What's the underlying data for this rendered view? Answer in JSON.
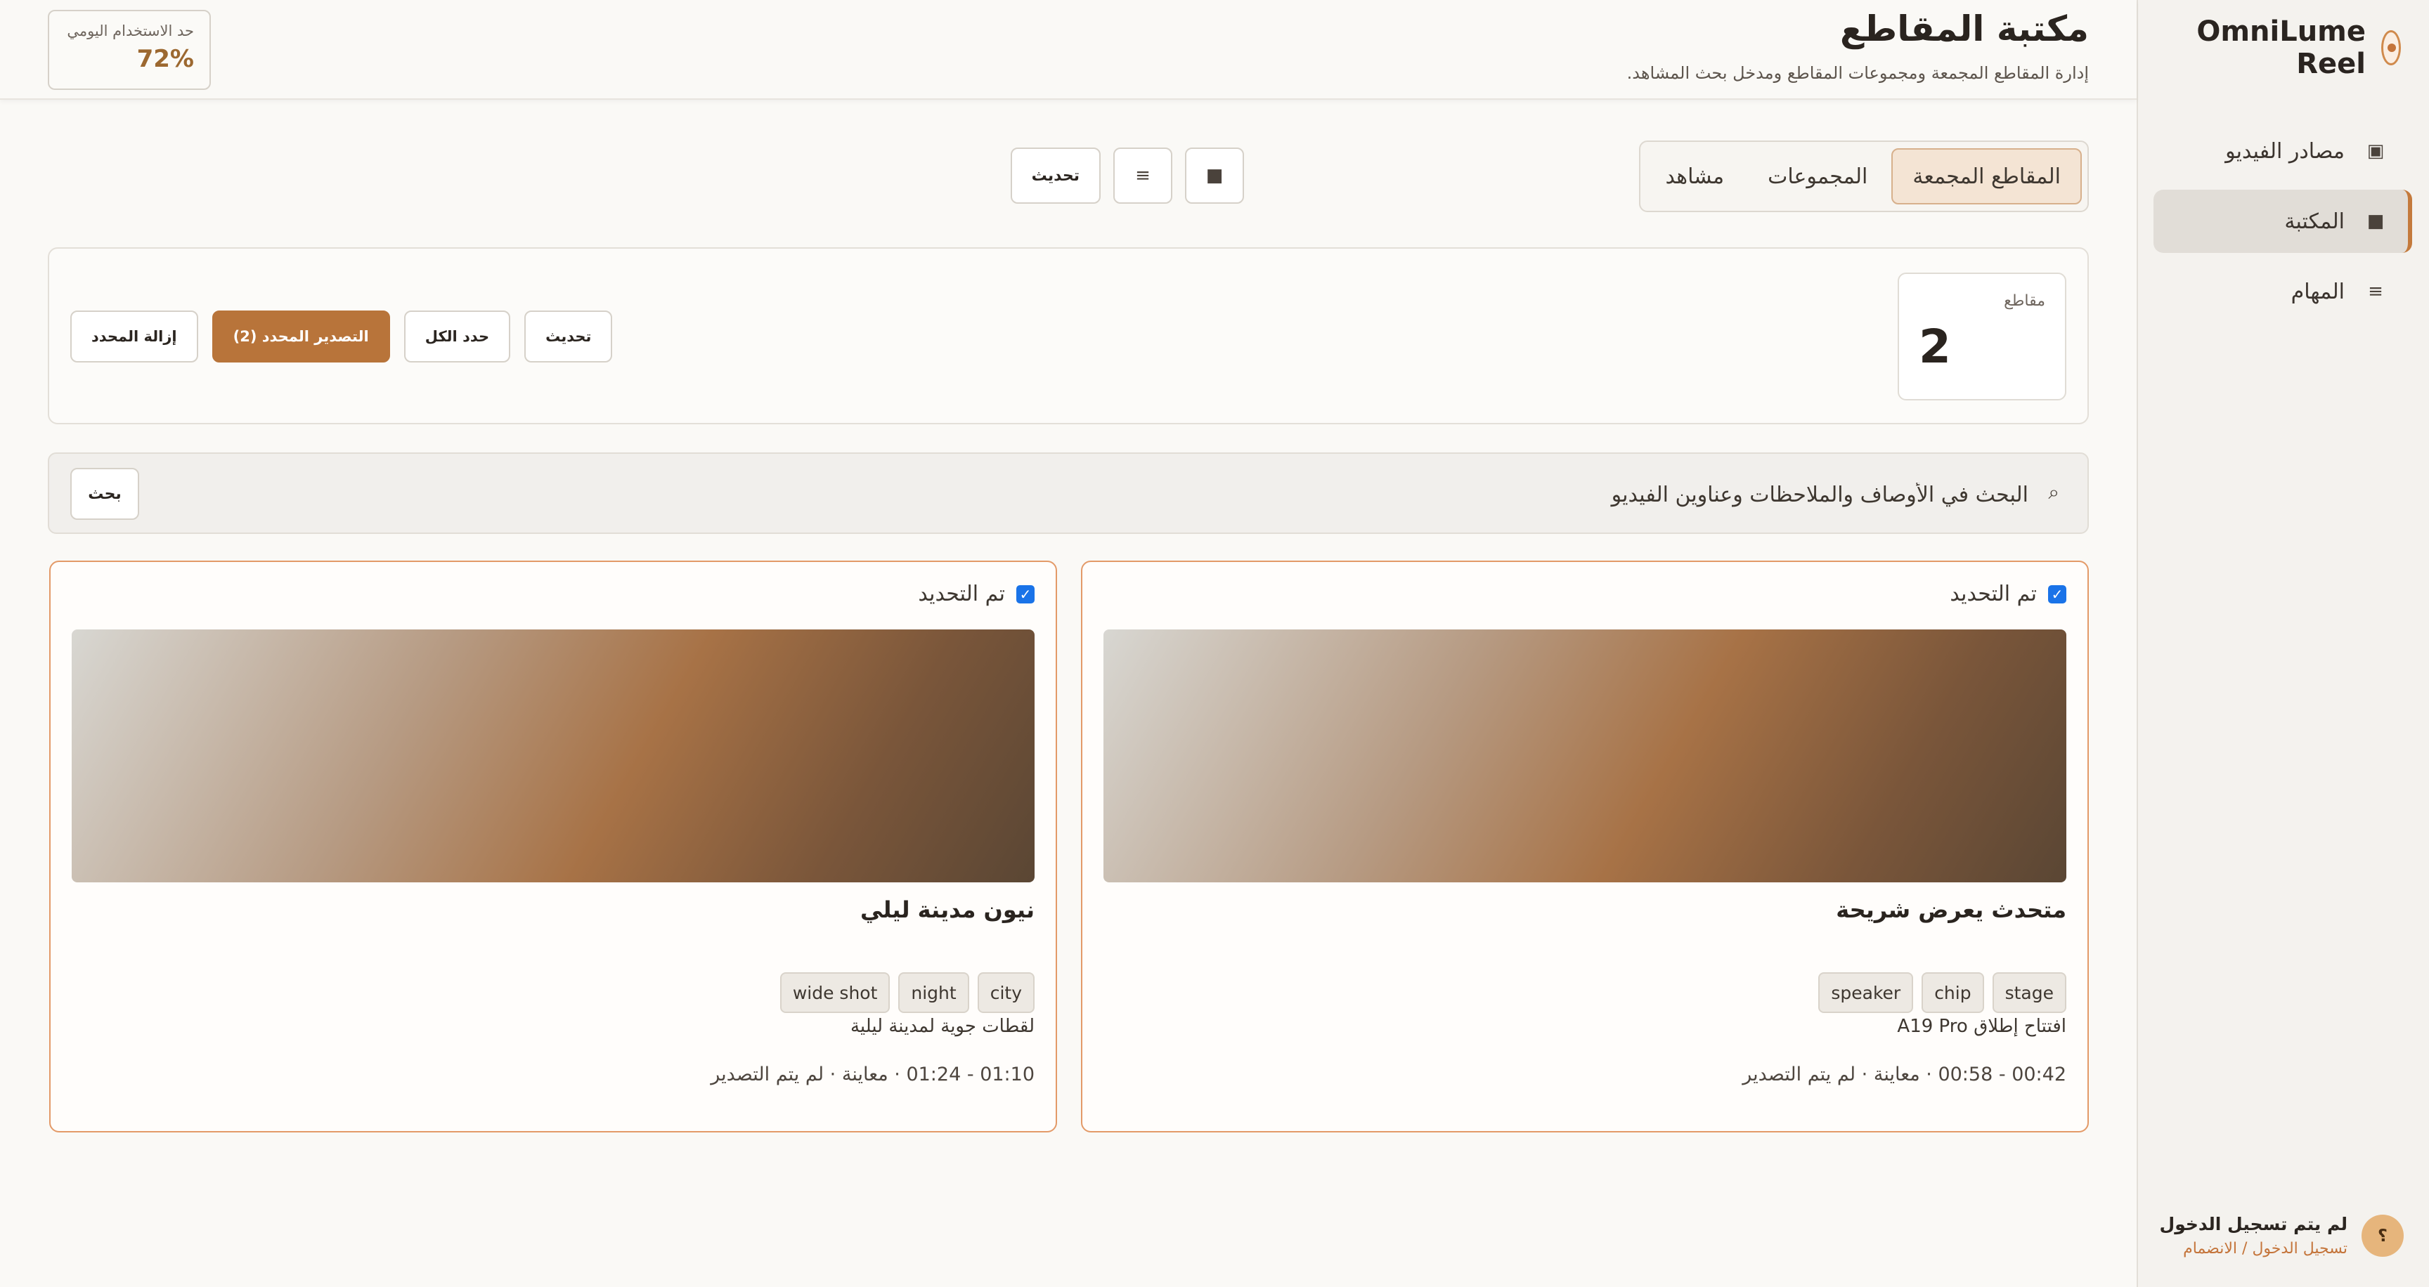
{
  "app": {
    "name": "OmniLume Reel"
  },
  "sidebar": {
    "items": [
      {
        "label": "مصادر الفيديو",
        "icon": "video-sources-icon",
        "glyph": "▣",
        "active": false
      },
      {
        "label": "المكتبة",
        "icon": "library-icon",
        "glyph": "■",
        "active": true
      },
      {
        "label": "المهام",
        "icon": "tasks-icon",
        "glyph": "≡",
        "active": false
      }
    ],
    "user": {
      "avatar": "؟",
      "status": "لم يتم تسجيل الدخول",
      "link": "تسجيل الدخول / الانضمام"
    }
  },
  "header": {
    "title": "مكتبة المقاطع",
    "subtitle": "إدارة المقاطع المجمعة ومجموعات المقاطع ومدخل بحث المشاهد.",
    "quota": {
      "label": "حد الاستخدام اليومي",
      "value": "72%"
    }
  },
  "tabs": [
    {
      "label": "المقاطع المجمعة",
      "active": true
    },
    {
      "label": "المجموعات",
      "active": false
    },
    {
      "label": "مشاهد",
      "active": false
    }
  ],
  "toolbar": {
    "grid_glyph": "■",
    "list_glyph": "≡",
    "refresh_label": "تحديث"
  },
  "stats": {
    "label": "مقاطع",
    "value": "2"
  },
  "actions": {
    "refresh": "تحديث",
    "select_all": "حدد الكل",
    "export_selected": "التصدير المحدد (2)",
    "remove_selected": "إزالة المحدد"
  },
  "search": {
    "placeholder": "البحث في الأوصاف والملاحظات وعناوين الفيديو",
    "icon_glyph": "⌕",
    "button": "بحث"
  },
  "clips": [
    {
      "selected_label": "تم التحديد",
      "title": "متحدث يعرض شريحة",
      "tags": [
        "stage",
        "chip",
        "speaker"
      ],
      "description": "افتتاح إطلاق A19 Pro",
      "meta": "00:42 - 00:58 · معاينة · لم يتم التصدير"
    },
    {
      "selected_label": "تم التحديد",
      "title": "نيون مدينة ليلي",
      "tags": [
        "city",
        "night",
        "wide shot"
      ],
      "description": "لقطات جوية لمدينة ليلية",
      "meta": "01:10 - 01:24 · معاينة · لم يتم التصدير"
    }
  ],
  "colors": {
    "accent": "#b8743a",
    "card_border": "#e39a68",
    "checkbox": "#1a73e8"
  }
}
